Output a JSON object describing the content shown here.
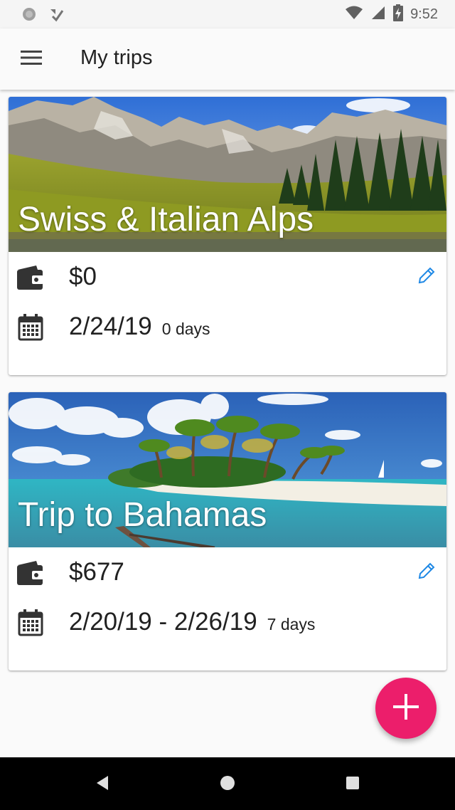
{
  "status_bar": {
    "time": "9:52",
    "icons": [
      "circle-notification-icon",
      "check-notification-icon",
      "wifi-icon",
      "signal-icon",
      "battery-charging-icon"
    ]
  },
  "app_bar": {
    "title": "My trips",
    "menu_icon": "hamburger-menu-icon"
  },
  "trips": [
    {
      "title": "Swiss & Italian Alps",
      "budget": "$0",
      "date": "2/24/19",
      "days": "0 days",
      "icons": {
        "budget": "wallet-icon",
        "date": "calendar-icon",
        "edit": "pencil-icon"
      }
    },
    {
      "title": "Trip to Bahamas",
      "budget": "$677",
      "date": "2/20/19 - 2/26/19",
      "days": "7 days",
      "icons": {
        "budget": "wallet-icon",
        "date": "calendar-icon",
        "edit": "pencil-icon"
      }
    }
  ],
  "fab": {
    "icon": "plus-icon"
  },
  "colors": {
    "accent": "#ec1e6b",
    "edit_icon": "#1e88e5",
    "card_bg": "#ffffff",
    "page_bg": "#fafafa"
  },
  "nav_bar": {
    "icons": [
      "back-triangle-icon",
      "home-circle-icon",
      "recents-square-icon"
    ]
  }
}
